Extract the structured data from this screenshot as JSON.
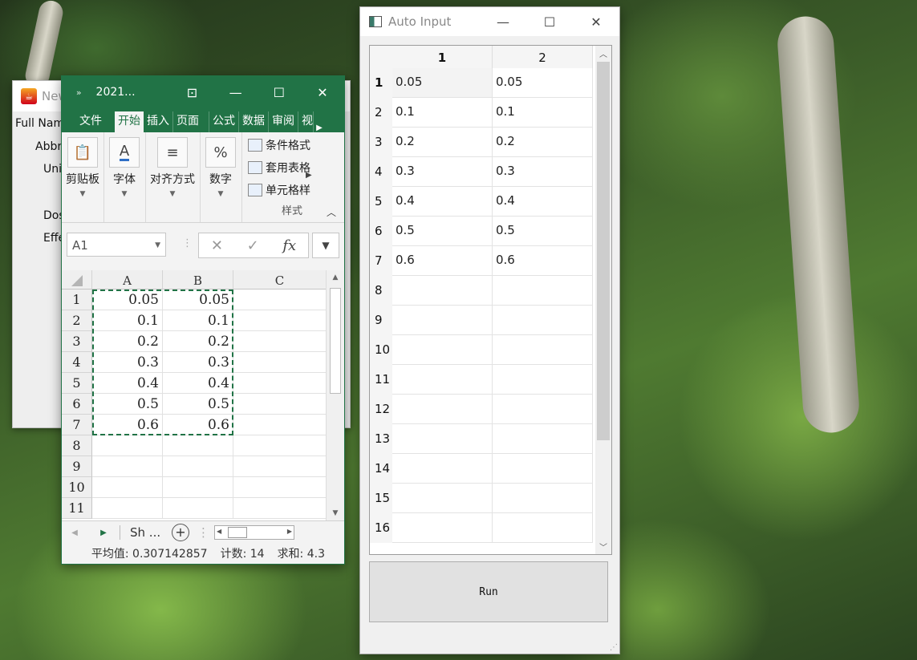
{
  "bg_window": {
    "title": "New",
    "labels": [
      "Full Nam",
      "Abbr",
      "Uni",
      "Dos",
      "Effe"
    ]
  },
  "excel": {
    "title": "2021...",
    "ribbon_tabs": [
      {
        "label": "文件"
      },
      {
        "label": "开始"
      },
      {
        "label": "插入"
      },
      {
        "label": "页面"
      },
      {
        "label": "公式"
      },
      {
        "label": "数据"
      },
      {
        "label": "审阅"
      },
      {
        "label": "视"
      }
    ],
    "groups": {
      "clipboard": "剪贴板",
      "font": "字体",
      "align": "对齐方式",
      "number": "数字",
      "styles": "样式"
    },
    "style_items": [
      "条件格式",
      "套用表格",
      "单元格样"
    ],
    "name_box": "A1",
    "columns": [
      "A",
      "B",
      "C"
    ],
    "rows": [
      {
        "n": "1",
        "a": "0.05",
        "b": "0.05"
      },
      {
        "n": "2",
        "a": "0.1",
        "b": "0.1"
      },
      {
        "n": "3",
        "a": "0.2",
        "b": "0.2"
      },
      {
        "n": "4",
        "a": "0.3",
        "b": "0.3"
      },
      {
        "n": "5",
        "a": "0.4",
        "b": "0.4"
      },
      {
        "n": "6",
        "a": "0.5",
        "b": "0.5"
      },
      {
        "n": "7",
        "a": "0.6",
        "b": "0.6"
      },
      {
        "n": "8",
        "a": "",
        "b": ""
      },
      {
        "n": "9",
        "a": "",
        "b": ""
      },
      {
        "n": "10",
        "a": "",
        "b": ""
      },
      {
        "n": "11",
        "a": "",
        "b": ""
      }
    ],
    "sheet_tab": "Sh ...",
    "status": {
      "average": "平均值: 0.307142857",
      "count": "计数: 14",
      "sum": "求和: 4.3"
    },
    "accent": "#217346"
  },
  "auto_input": {
    "title": "Auto Input",
    "columns": [
      "1",
      "2"
    ],
    "rows": [
      {
        "n": "1",
        "c1": "0.05",
        "c2": "0.05"
      },
      {
        "n": "2",
        "c1": "0.1",
        "c2": "0.1"
      },
      {
        "n": "3",
        "c1": "0.2",
        "c2": "0.2"
      },
      {
        "n": "4",
        "c1": "0.3",
        "c2": "0.3"
      },
      {
        "n": "5",
        "c1": "0.4",
        "c2": "0.4"
      },
      {
        "n": "6",
        "c1": "0.5",
        "c2": "0.5"
      },
      {
        "n": "7",
        "c1": "0.6",
        "c2": "0.6"
      },
      {
        "n": "8",
        "c1": "",
        "c2": ""
      },
      {
        "n": "9",
        "c1": "",
        "c2": ""
      },
      {
        "n": "10",
        "c1": "",
        "c2": ""
      },
      {
        "n": "11",
        "c1": "",
        "c2": ""
      },
      {
        "n": "12",
        "c1": "",
        "c2": ""
      },
      {
        "n": "13",
        "c1": "",
        "c2": ""
      },
      {
        "n": "14",
        "c1": "",
        "c2": ""
      },
      {
        "n": "15",
        "c1": "",
        "c2": ""
      },
      {
        "n": "16",
        "c1": "",
        "c2": ""
      }
    ],
    "run_label": "Run"
  }
}
